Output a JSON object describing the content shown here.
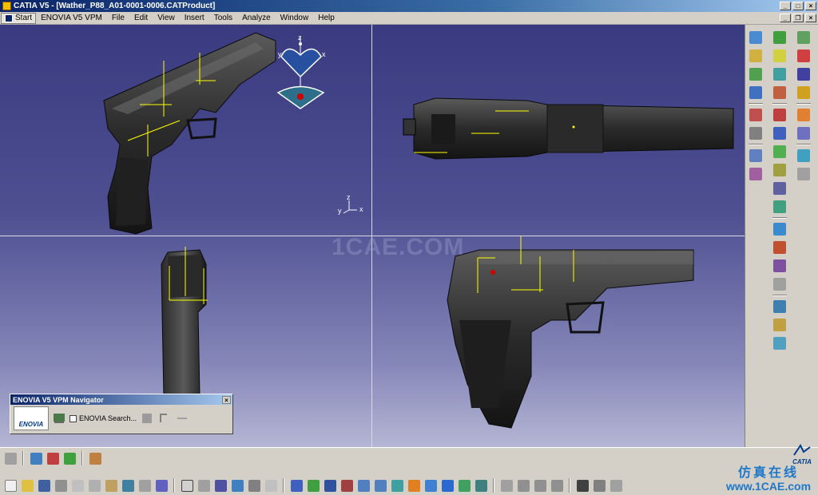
{
  "window": {
    "title": "CATIA V5 - [Wather_P88_A01-0001-0006.CATProduct]"
  },
  "menu": {
    "items": [
      "Start",
      "ENOVIA V5 VPM",
      "File",
      "Edit",
      "View",
      "Insert",
      "Tools",
      "Analyze",
      "Window",
      "Help"
    ]
  },
  "viewport": {
    "watermark": "1CAE.COM",
    "compass": {
      "z": "z",
      "x": "x",
      "y": "y"
    },
    "axis_small": {
      "x": "x",
      "y": "y",
      "z": "z"
    }
  },
  "navigator": {
    "title": "ENOVIA V5 VPM Navigator",
    "logo": "ENOVIA",
    "search_label": "ENOVIA Search..."
  },
  "branding": {
    "catia": "CATIA",
    "site_cn": "仿真在线",
    "site_url": "www.1CAE.com"
  },
  "colors": {
    "accent": "#0a246a",
    "viewport_top": "#3a3a80",
    "axis": "#ffff00"
  }
}
